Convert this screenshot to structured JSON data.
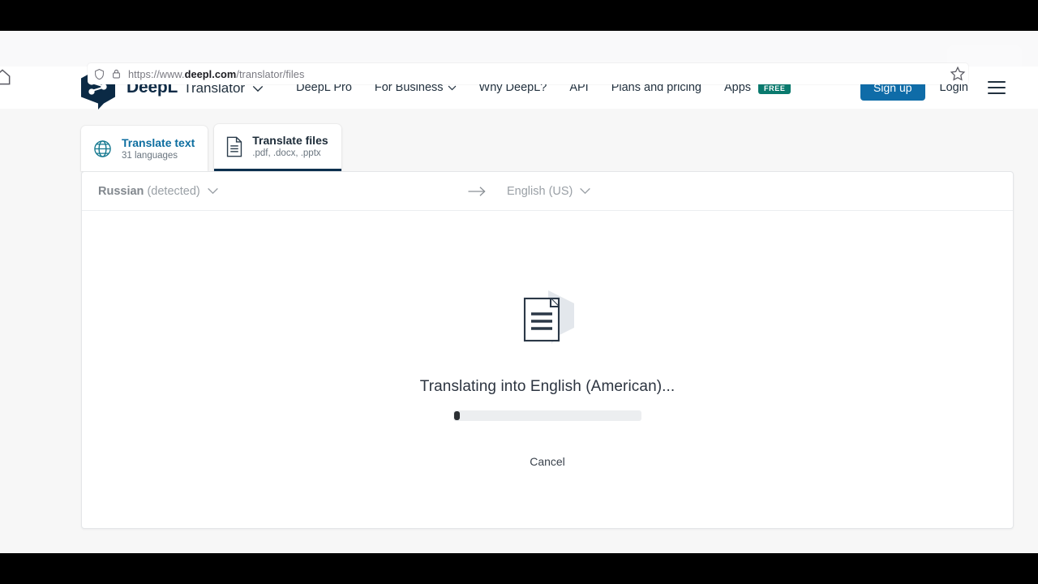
{
  "browser": {
    "url_prefix": "https://www.",
    "url_domain": "deepl.com",
    "url_path": "/translator/files",
    "icons": {
      "home": "home-icon",
      "shield": "shield-icon",
      "lock": "lock-icon",
      "bookmark": "star-icon"
    }
  },
  "header": {
    "brand_name": "DeepL",
    "brand_product": "Translator",
    "nav": [
      {
        "label": "DeepL Pro",
        "has_caret": false,
        "badge": ""
      },
      {
        "label": "For Business",
        "has_caret": true,
        "badge": ""
      },
      {
        "label": "Why DeepL?",
        "has_caret": false,
        "badge": ""
      },
      {
        "label": "API",
        "has_caret": false,
        "badge": ""
      },
      {
        "label": "Plans and pricing",
        "has_caret": false,
        "badge": ""
      },
      {
        "label": "Apps",
        "has_caret": false,
        "badge": "FREE"
      }
    ],
    "signup_label": "Sign up",
    "login_label": "Login",
    "menu_label": "Menu"
  },
  "tabs": [
    {
      "title": "Translate text",
      "subtitle": "31 languages",
      "icon": "globe-icon",
      "active": false
    },
    {
      "title": "Translate files",
      "subtitle": ".pdf, .docx, .pptx",
      "icon": "document-icon",
      "active": true
    }
  ],
  "language_bar": {
    "source_language": "Russian",
    "source_detected_suffix": "(detected)",
    "target_language": "English (US)",
    "arrow": "arrow-right-icon"
  },
  "translation_status": {
    "message": "Translating into English (American)...",
    "progress_percent": 3,
    "cancel_label": "Cancel",
    "illustration": "document-translate-icon"
  },
  "colors": {
    "brand_navy": "#0f2b46",
    "accent_blue": "#0f6ca8",
    "link_blue": "#0d6ea0",
    "free_badge_green": "#0a7a6e",
    "notification_red": "#e8342a",
    "page_background": "#f7f7f7",
    "active_tab_underline": "#0b2f4e"
  }
}
